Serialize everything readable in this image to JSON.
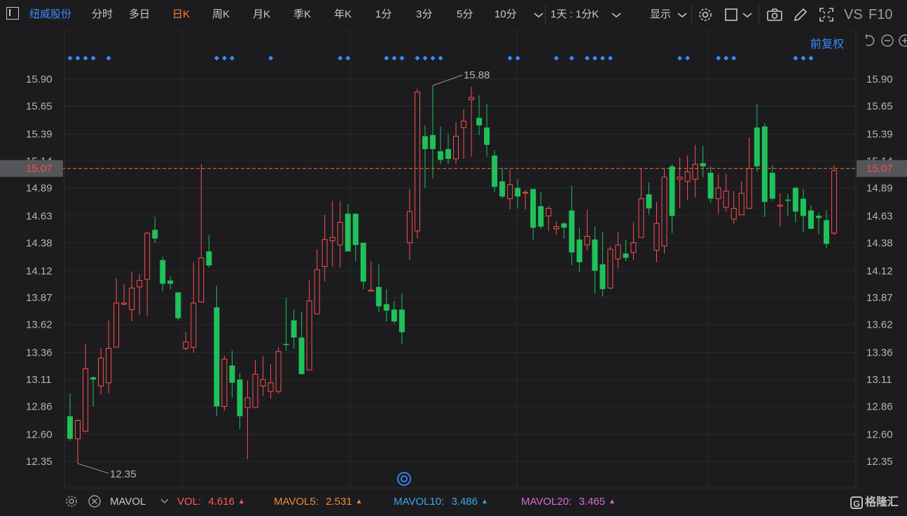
{
  "toolbar": {
    "stock_name": "纽威股份",
    "periods": [
      "分时",
      "多日",
      "日K",
      "周K",
      "月K",
      "季K",
      "年K",
      "1分",
      "3分",
      "5分",
      "10分"
    ],
    "active_period": "日K",
    "interval_select": "1天 : 1分K",
    "display_label": "显示",
    "vs_label": "VS",
    "f10_label": "F10"
  },
  "adjust_label": "前复权",
  "price_axis": {
    "ticks": [
      "15.90",
      "15.65",
      "15.39",
      "15.14",
      "14.89",
      "14.63",
      "14.38",
      "14.12",
      "13.87",
      "13.62",
      "13.36",
      "13.11",
      "12.86",
      "12.60",
      "12.35"
    ],
    "current_price": "15.07",
    "high_label": "15.88",
    "low_label": "12.35"
  },
  "chart_data": {
    "type": "candlestick",
    "ylim": [
      12.15,
      16.05
    ],
    "current_price": 15.07,
    "colors": {
      "up": "#ff4d4d",
      "down": "#1fc15a",
      "marker": "#3d8bff",
      "price_line": "#e8712c"
    },
    "candles": [
      [
        12.77,
        12.56,
        12.98,
        12.54
      ],
      [
        12.56,
        12.73,
        12.74,
        12.33
      ],
      [
        12.63,
        13.21,
        13.44,
        12.62
      ],
      [
        13.13,
        13.11,
        13.14,
        12.86
      ],
      [
        13.05,
        13.31,
        13.4,
        12.97
      ],
      [
        13.08,
        13.4,
        13.66,
        12.98
      ],
      [
        13.41,
        13.82,
        14.05,
        13.42
      ],
      [
        13.81,
        13.82,
        14.0,
        13.8
      ],
      [
        13.76,
        13.96,
        14.11,
        13.65
      ],
      [
        13.97,
        14.03,
        14.09,
        13.71
      ],
      [
        14.04,
        14.47,
        14.48,
        13.7
      ],
      [
        14.5,
        14.42,
        14.62,
        14.38
      ],
      [
        14.22,
        14.0,
        14.25,
        13.93
      ],
      [
        14.03,
        14.0,
        14.07,
        13.95
      ],
      [
        13.92,
        13.68,
        13.9,
        13.66
      ],
      [
        13.4,
        13.46,
        13.55,
        13.38
      ],
      [
        13.41,
        13.82,
        14.2,
        13.36
      ],
      [
        13.83,
        14.24,
        15.11,
        13.95
      ],
      [
        14.3,
        14.17,
        14.45,
        14.15
      ],
      [
        13.78,
        12.86,
        13.98,
        12.77
      ],
      [
        12.86,
        13.3,
        13.33,
        12.82
      ],
      [
        13.24,
        13.08,
        13.38,
        12.94
      ],
      [
        13.11,
        12.77,
        13.17,
        12.65
      ],
      [
        12.85,
        12.94,
        13.1,
        12.37
      ],
      [
        12.85,
        13.16,
        13.29,
        12.85
      ],
      [
        13.05,
        13.11,
        13.33,
        12.96
      ],
      [
        13.0,
        13.08,
        13.25,
        12.93
      ],
      [
        13.0,
        13.37,
        13.41,
        12.98
      ],
      [
        13.44,
        13.43,
        13.87,
        13.38
      ],
      [
        13.66,
        13.5,
        13.76,
        13.4
      ],
      [
        13.5,
        13.16,
        13.74,
        13.17
      ],
      [
        13.2,
        13.84,
        14.03,
        13.2
      ],
      [
        13.72,
        14.13,
        14.32,
        13.72
      ],
      [
        14.16,
        14.41,
        14.64,
        14.02
      ],
      [
        14.4,
        14.43,
        14.77,
        14.16
      ],
      [
        14.36,
        14.57,
        14.77,
        14.15
      ],
      [
        14.65,
        14.3,
        14.74,
        14.3
      ],
      [
        14.65,
        14.36,
        14.6,
        14.21
      ],
      [
        14.38,
        14.02,
        14.38,
        13.95
      ],
      [
        13.93,
        13.94,
        14.21,
        13.93
      ],
      [
        13.97,
        13.79,
        14.18,
        13.74
      ],
      [
        13.81,
        13.75,
        13.95,
        13.65
      ],
      [
        13.76,
        13.65,
        13.84,
        13.63
      ],
      [
        13.76,
        13.55,
        13.91,
        13.44
      ],
      [
        14.38,
        14.67,
        14.88,
        14.22
      ],
      [
        14.49,
        15.78,
        15.81,
        14.42
      ],
      [
        15.37,
        15.25,
        15.47,
        14.89
      ],
      [
        15.38,
        15.25,
        15.84,
        14.98
      ],
      [
        15.23,
        15.15,
        15.46,
        15.11
      ],
      [
        15.25,
        15.16,
        15.39,
        15.11
      ],
      [
        15.16,
        15.37,
        15.5,
        15.11
      ],
      [
        15.45,
        15.51,
        15.62,
        15.16
      ],
      [
        15.71,
        15.73,
        15.83,
        15.18
      ],
      [
        15.54,
        15.47,
        15.75,
        15.38
      ],
      [
        15.45,
        15.29,
        15.67,
        15.18
      ],
      [
        15.19,
        14.9,
        15.24,
        14.85
      ],
      [
        14.95,
        14.81,
        15.08,
        14.79
      ],
      [
        14.79,
        14.92,
        15.06,
        14.69
      ],
      [
        14.89,
        14.81,
        14.97,
        14.7
      ],
      [
        14.85,
        14.85,
        14.87,
        14.69
      ],
      [
        14.88,
        14.52,
        14.88,
        14.41
      ],
      [
        14.72,
        14.53,
        14.85,
        14.51
      ],
      [
        14.63,
        14.7,
        14.72,
        14.49
      ],
      [
        14.51,
        14.53,
        14.58,
        14.45
      ],
      [
        14.56,
        14.52,
        14.57,
        14.42
      ],
      [
        14.68,
        14.29,
        14.91,
        14.17
      ],
      [
        14.41,
        14.2,
        14.52,
        14.11
      ],
      [
        14.36,
        14.44,
        14.69,
        14.31
      ],
      [
        14.41,
        14.12,
        14.53,
        13.91
      ],
      [
        14.18,
        13.95,
        14.48,
        13.88
      ],
      [
        13.96,
        14.32,
        14.35,
        13.95
      ],
      [
        14.23,
        14.36,
        14.48,
        14.14
      ],
      [
        14.28,
        14.24,
        14.41,
        14.21
      ],
      [
        14.29,
        14.38,
        14.57,
        14.22
      ],
      [
        14.43,
        14.79,
        15.07,
        14.44
      ],
      [
        14.83,
        14.7,
        14.94,
        14.64
      ],
      [
        14.31,
        14.56,
        14.76,
        14.2
      ],
      [
        14.35,
        14.99,
        15.07,
        14.28
      ],
      [
        15.09,
        14.63,
        15.11,
        14.47
      ],
      [
        14.97,
        14.99,
        15.17,
        14.7
      ],
      [
        14.95,
        15.04,
        15.19,
        14.78
      ],
      [
        14.97,
        15.11,
        15.29,
        14.8
      ],
      [
        15.12,
        15.09,
        15.28,
        14.99
      ],
      [
        15.03,
        14.79,
        15.09,
        14.75
      ],
      [
        14.79,
        14.89,
        15.02,
        14.65
      ],
      [
        14.71,
        14.86,
        15.02,
        14.67
      ],
      [
        14.6,
        14.7,
        14.86,
        14.56
      ],
      [
        14.64,
        14.84,
        14.95,
        14.68
      ],
      [
        14.7,
        15.07,
        15.36,
        14.72
      ],
      [
        15.45,
        15.09,
        15.67,
        15.04
      ],
      [
        15.46,
        14.76,
        15.49,
        14.62
      ],
      [
        15.03,
        14.79,
        15.1,
        14.77
      ],
      [
        14.72,
        14.73,
        14.84,
        14.53
      ],
      [
        14.78,
        14.77,
        14.83,
        14.63
      ],
      [
        14.89,
        14.67,
        14.9,
        14.57
      ],
      [
        14.79,
        14.63,
        14.88,
        14.48
      ],
      [
        14.68,
        14.51,
        14.73,
        14.51
      ],
      [
        14.63,
        14.61,
        14.66,
        14.46
      ],
      [
        14.59,
        14.37,
        14.68,
        14.33
      ],
      [
        14.47,
        15.05,
        15.1,
        14.45
      ]
    ],
    "markers_on_candles": [
      0,
      1,
      2,
      3,
      5,
      19,
      20,
      21,
      26,
      35,
      36,
      41,
      42,
      43,
      45,
      46,
      47,
      48,
      57,
      58,
      63,
      65,
      67,
      68,
      69,
      70,
      79,
      80,
      84,
      85,
      86,
      94,
      95,
      96
    ],
    "volume_indicator": {
      "name": "MAVOL",
      "vol": 4.616,
      "mavol5": 2.531,
      "mavol10": 3.486,
      "mavol20": 3.465
    }
  },
  "footer": {
    "indicator": "MAVOL",
    "vol_label": "VOL:",
    "vol_value": "4.616",
    "mavol5_label": "MAVOL5:",
    "mavol5_value": "2.531",
    "mavol10_label": "MAVOL10:",
    "mavol10_value": "3.486",
    "mavol20_label": "MAVOL20:",
    "mavol20_value": "3.465",
    "colors": {
      "vol": "#ff5a5a",
      "mavol5": "#f08a24",
      "mavol10": "#3aa8e8",
      "mavol20": "#d86ad8"
    }
  },
  "logo_text": "格隆汇",
  "logo_glyph": "G"
}
